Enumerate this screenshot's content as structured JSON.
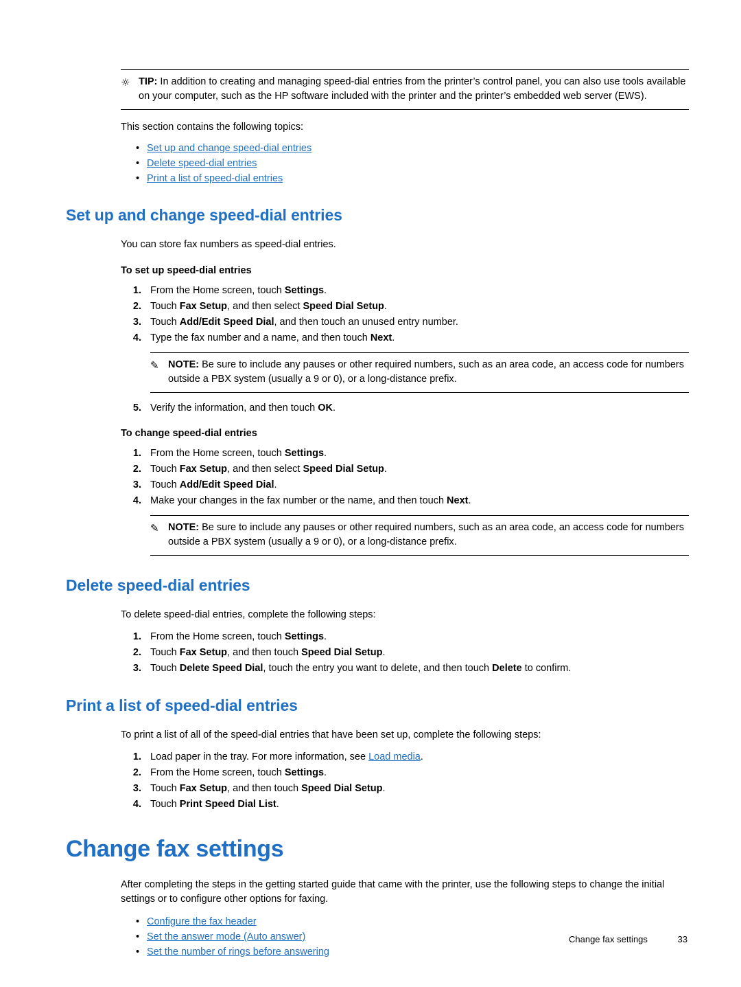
{
  "tip": {
    "icon": "lightbulb-icon",
    "label": "TIP:",
    "text": "In addition to creating and managing speed-dial entries from the printer’s control panel, you can also use tools available on your computer, such as the HP software included with the printer and the printer’s embedded web server (EWS)."
  },
  "intro": {
    "text": "This section contains the following topics:",
    "links": [
      "Set up and change speed-dial entries",
      "Delete speed-dial entries",
      "Print a list of speed-dial entries"
    ]
  },
  "section1": {
    "heading": "Set up and change speed-dial entries",
    "intro": "You can store fax numbers as speed-dial entries.",
    "sub1": {
      "heading": "To set up speed-dial entries",
      "steps": [
        {
          "n": "1.",
          "html": "From the Home screen, touch <b>Settings</b>."
        },
        {
          "n": "2.",
          "html": "Touch <b>Fax Setup</b>, and then select <b>Speed Dial Setup</b>."
        },
        {
          "n": "3.",
          "html": "Touch <b>Add/Edit Speed Dial</b>, and then touch an unused entry number."
        },
        {
          "n": "4.",
          "html": "Type the fax number and a name, and then touch <b>Next</b>."
        }
      ],
      "note": {
        "icon": "note-icon",
        "label": "NOTE:",
        "text": "Be sure to include any pauses or other required numbers, such as an area code, an access code for numbers outside a PBX system (usually a 9 or 0), or a long-distance prefix."
      },
      "step5": {
        "n": "5.",
        "html": "Verify the information, and then touch <b>OK</b>."
      }
    },
    "sub2": {
      "heading": "To change speed-dial entries",
      "steps": [
        {
          "n": "1.",
          "html": "From the Home screen, touch <b>Settings</b>."
        },
        {
          "n": "2.",
          "html": "Touch <b>Fax Setup</b>, and then select <b>Speed Dial Setup</b>."
        },
        {
          "n": "3.",
          "html": "Touch <b>Add/Edit Speed Dial</b>."
        },
        {
          "n": "4.",
          "html": "Make your changes in the fax number or the name, and then touch <b>Next</b>."
        }
      ],
      "note": {
        "icon": "note-icon",
        "label": "NOTE:",
        "text": "Be sure to include any pauses or other required numbers, such as an area code, an access code for numbers outside a PBX system (usually a 9 or 0), or a long-distance prefix."
      }
    }
  },
  "section2": {
    "heading": "Delete speed-dial entries",
    "intro": "To delete speed-dial entries, complete the following steps:",
    "steps": [
      {
        "n": "1.",
        "html": "From the Home screen, touch <b>Settings</b>."
      },
      {
        "n": "2.",
        "html": "Touch <b>Fax Setup</b>, and then touch <b>Speed Dial Setup</b>."
      },
      {
        "n": "3.",
        "html": "Touch <b>Delete Speed Dial</b>, touch the entry you want to delete, and then touch <b>Delete</b> to confirm."
      }
    ]
  },
  "section3": {
    "heading": "Print a list of speed-dial entries",
    "intro": "To print a list of all of the speed-dial entries that have been set up, complete the following steps:",
    "steps": [
      {
        "n": "1.",
        "html": "Load paper in the tray. For more information, see <a class=\"inline-link\" href=\"#\" data-name=\"load-media-link\" data-interactable=\"true\">Load media</a>."
      },
      {
        "n": "2.",
        "html": "From the Home screen, touch <b>Settings</b>."
      },
      {
        "n": "3.",
        "html": "Touch <b>Fax Setup</b>, and then touch <b>Speed Dial Setup</b>."
      },
      {
        "n": "4.",
        "html": "Touch <b>Print Speed Dial List</b>."
      }
    ]
  },
  "chapter": {
    "heading": "Change fax settings",
    "intro": "After completing the steps in the getting started guide that came with the printer, use the following steps to change the initial settings or to configure other options for faxing.",
    "links": [
      "Configure the fax header",
      "Set the answer mode (Auto answer)",
      "Set the number of rings before answering"
    ]
  },
  "footer": {
    "title": "Change fax settings",
    "page": "33"
  }
}
